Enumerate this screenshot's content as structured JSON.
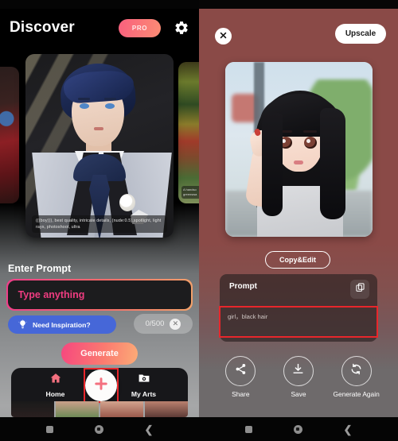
{
  "left_panel": {
    "header": {
      "title": "Discover",
      "pro_badge": "PRO",
      "settings_icon": "gear-icon"
    },
    "carousel": {
      "main_card_caption": "(((boy))), best quality, intricate details, (nude:0.5),spotlight, light rays, photoshoot, ultra",
      "right_card_caption": "A handso greenswa"
    },
    "prompt_section": {
      "label": "Enter Prompt",
      "input_placeholder": "Type anything",
      "input_value": "",
      "inspiration_button": "Need Inspiration?",
      "inspiration_icon": "lightbulb-icon",
      "char_counter": "0/500",
      "clear_icon": "close-circle-icon",
      "generate_button": "Generate"
    },
    "tabbar": {
      "items": [
        {
          "label": "Home",
          "icon": "home-icon"
        },
        {
          "label": "My Arts",
          "icon": "folder-camera-icon"
        }
      ],
      "fab_icon": "plus-icon"
    }
  },
  "right_panel": {
    "header": {
      "close_icon": "close-icon",
      "upscale_button": "Upscale"
    },
    "copy_edit_button": "Copy&Edit",
    "prompt_card": {
      "label": "Prompt",
      "copy_icon": "copy-icon",
      "value": "girl，black hair"
    },
    "actions": [
      {
        "label": "Share",
        "icon": "share-icon"
      },
      {
        "label": "Save",
        "icon": "download-icon"
      },
      {
        "label": "Generate Again",
        "icon": "refresh-icon"
      }
    ]
  },
  "colors": {
    "accent_pink": "#f6477f",
    "accent_orange": "#fbac77",
    "blue_button": "#4667d8",
    "annotation_red": "#e8262b",
    "right_bg": "#8a4a47"
  }
}
